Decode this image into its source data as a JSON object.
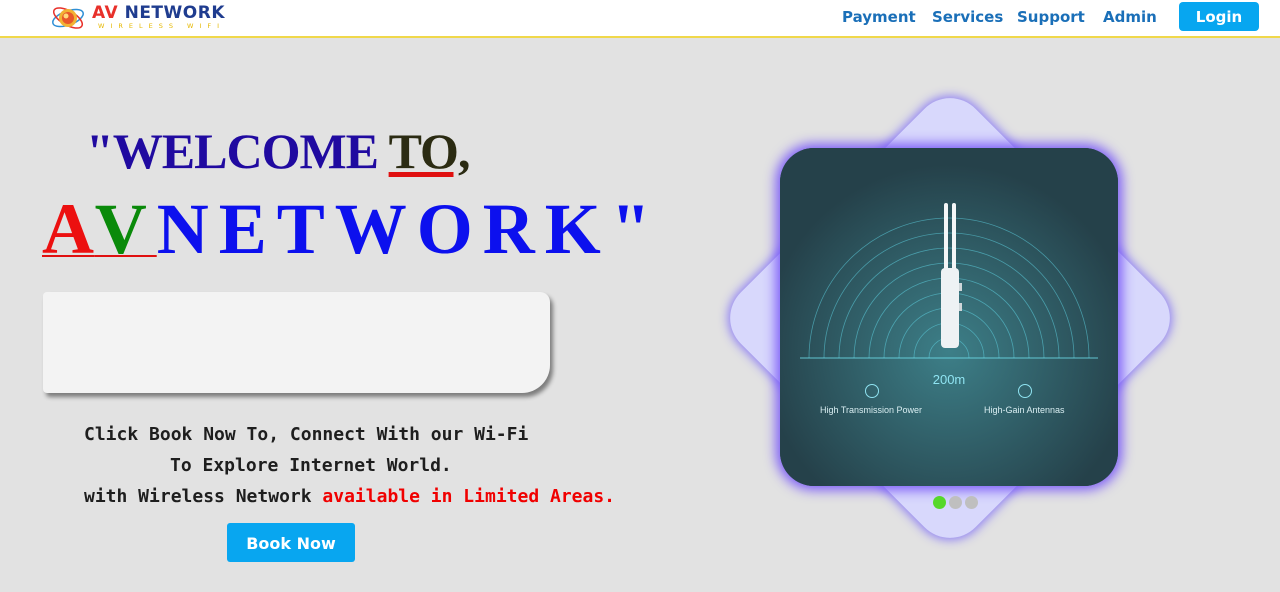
{
  "header": {
    "logo": {
      "brand_av": "AV",
      "brand_network": "NETWORK",
      "tagline": "WIRELESS WIFI"
    },
    "nav": [
      {
        "label": "Payment"
      },
      {
        "label": "Services"
      },
      {
        "label": "Support"
      },
      {
        "label": "Admin"
      }
    ],
    "login_label": "Login"
  },
  "hero": {
    "welcome_prefix": "\"WELCOME ",
    "welcome_to": "TO,",
    "brand_a": "A",
    "brand_v": "V",
    "brand_rest": "NETWORK\"",
    "message_line1": "Click Book Now To, Connect With our Wi-Fi",
    "message_line2": "To Explore Internet World.",
    "message_line3_prefix": "with Wireless Network ",
    "message_line3_highlight": "available in Limited Areas.",
    "book_label": "Book Now"
  },
  "product": {
    "range_label": "200m",
    "feature_left": "High Transmission Power",
    "feature_right": "High-Gain Antennas",
    "carousel": {
      "count": 3,
      "active_index": 0
    }
  },
  "colors": {
    "accent": "#07a6f0",
    "nav_link": "#1a6fb8",
    "highlight_red": "#f00000",
    "dot_active": "#56d82a"
  }
}
